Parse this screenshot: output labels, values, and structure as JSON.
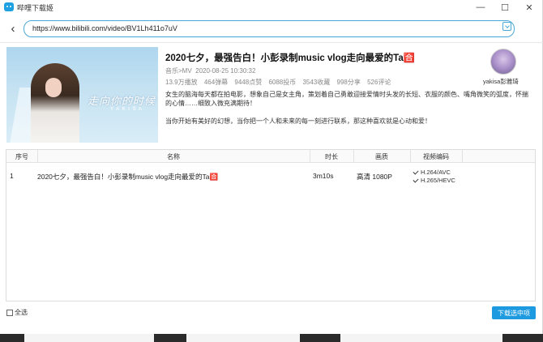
{
  "window": {
    "title": "哔哩下载姬"
  },
  "window_controls": {
    "minimize": "—",
    "maximize": "☐",
    "close": "✕"
  },
  "urlbar": {
    "back_glyph": "‹",
    "url": "https://www.bilibili.com/video/BV1Lh411o7uV"
  },
  "cover": {
    "text": "走向你的时候",
    "subtext": "Y A K I S A"
  },
  "video": {
    "title": "2020七夕，最强告白！小彭录制music vlog走向最爱的Ta🈴",
    "category": "音乐>MV",
    "datetime": "2020-08-25 10:30:32",
    "stats": [
      "13.9万播放",
      "464弹幕",
      "9448点赞",
      "6088投币",
      "3543收藏",
      "998分享",
      "526评论"
    ],
    "description": [
      "女生的脑海每天都在拍电影，想象自己是女主角，策划着自己勇敢迎接爱情时头发的长短、衣服的颜色、嘴角微笑的弧度，怀揣的心情……细致入微充满期待！",
      "当你开始有美好的幻想，当你把一个人和未来的每一刻进行联系，那这种喜欢就是心动和爱！"
    ]
  },
  "uploader": {
    "name": "yakisa彭雅琦"
  },
  "table": {
    "headers": {
      "index": "序号",
      "name": "名称",
      "duration": "时长",
      "quality": "画质",
      "codec": "视频编码"
    },
    "rows": [
      {
        "index": "1",
        "name": "2020七夕，最强告白！小彭录制music vlog走向最爱的Ta🈴",
        "duration": "3m10s",
        "quality": "高清 1080P",
        "codecs": [
          "H.264/AVC",
          "H.265/HEVC"
        ]
      }
    ]
  },
  "footer": {
    "select_all": "全选",
    "download_button": "下载选中项"
  },
  "colors": {
    "accent": "#1e9be0",
    "url_border": "#4aa8d6"
  }
}
